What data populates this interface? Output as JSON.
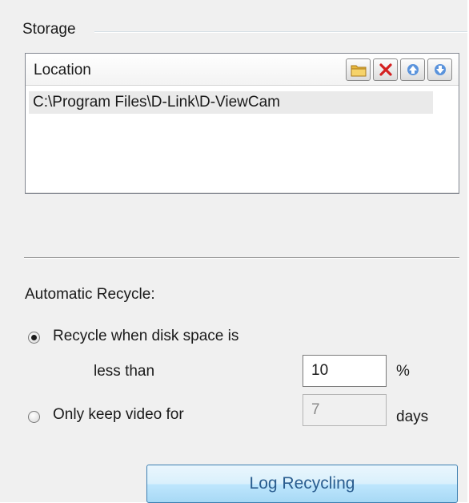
{
  "storage": {
    "group_title": "Storage",
    "list": {
      "header": "Location",
      "toolbar": [
        {
          "icon": "folder-icon"
        },
        {
          "icon": "delete-icon"
        },
        {
          "icon": "arrow-up-icon"
        },
        {
          "icon": "arrow-down-icon"
        }
      ],
      "items": [
        "C:\\Program Files\\D-Link\\D-ViewCam"
      ]
    }
  },
  "recycle": {
    "heading": "Automatic Recycle:",
    "option_disk": {
      "label": "Recycle when disk space is",
      "sub_label": "less than",
      "value": "10",
      "unit": "%",
      "checked": true
    },
    "option_days": {
      "label": "Only keep video for",
      "value": "7",
      "unit": "days",
      "checked": false
    }
  },
  "log_button": "Log Recycling",
  "colors": {
    "panel_bg": "#f0f0f0",
    "button_text": "#2a5d8f",
    "delete_red": "#d42020",
    "arrow_blue": "#2f6fc6"
  }
}
